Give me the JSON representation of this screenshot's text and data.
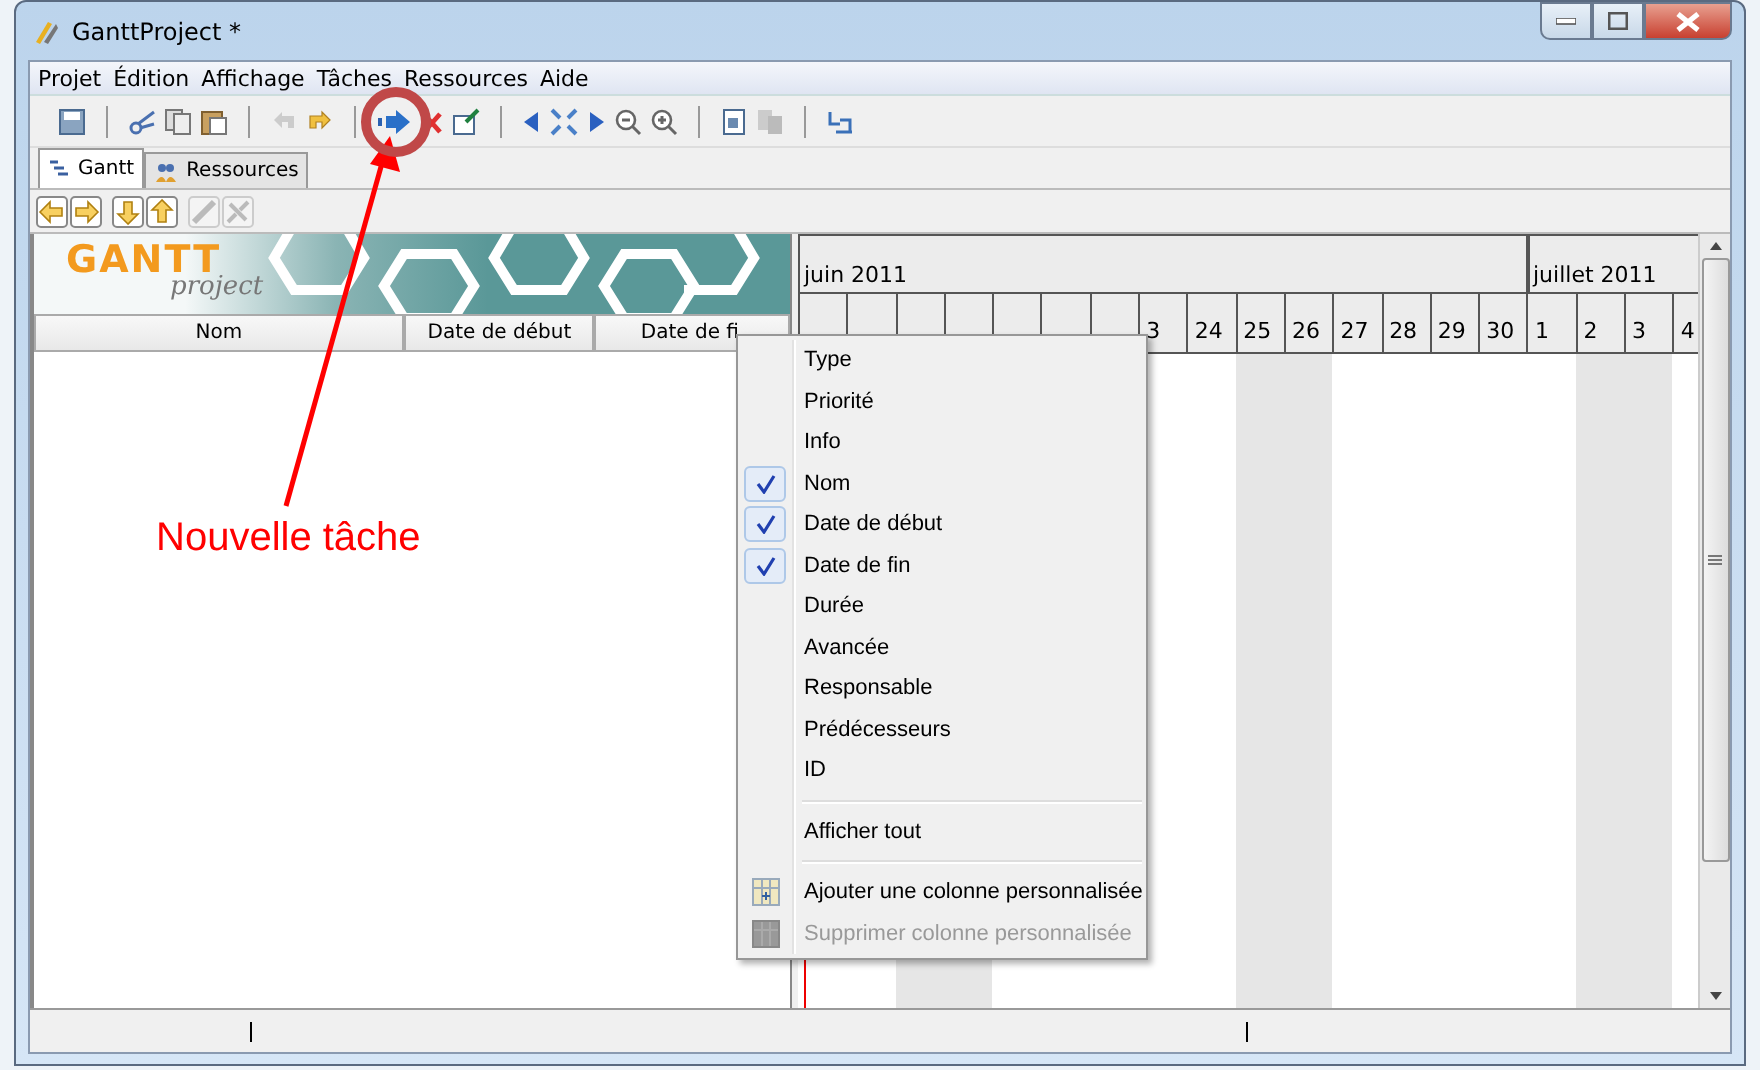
{
  "window": {
    "title": "GanttProject *"
  },
  "menu": [
    "Projet",
    "Édition",
    "Affichage",
    "Tâches",
    "Ressources",
    "Aide"
  ],
  "tabs": [
    {
      "label": "Gantt",
      "selected": true
    },
    {
      "label": "Ressources",
      "selected": false
    }
  ],
  "logo": {
    "brand": "GANTT",
    "sub": "project"
  },
  "table": {
    "columns": [
      "Nom",
      "Date de début",
      "Date de fi"
    ]
  },
  "timeline": {
    "months": [
      {
        "label": "juin 2011",
        "days": [
          {
            "weekend": false
          },
          {
            "weekend": false
          },
          {
            "weekend": true
          },
          {
            "weekend": true
          },
          {
            "weekend": false
          },
          {
            "weekend": false
          },
          {
            "weekend": false
          },
          {
            "label": "3",
            "weekend": false
          },
          {
            "label": "24",
            "weekend": false
          },
          {
            "label": "25",
            "weekend": true
          },
          {
            "label": "26",
            "weekend": true
          },
          {
            "label": "27",
            "weekend": false
          },
          {
            "label": "28",
            "weekend": false
          },
          {
            "label": "29",
            "weekend": false
          },
          {
            "label": "30",
            "weekend": false
          }
        ]
      },
      {
        "label": "juillet 2011",
        "days": [
          {
            "label": "1",
            "weekend": false
          },
          {
            "label": "2",
            "weekend": true
          },
          {
            "label": "3",
            "weekend": true
          },
          {
            "label": "4",
            "weekend": false
          }
        ]
      }
    ]
  },
  "context_menu": [
    {
      "kind": "check",
      "label": "Type",
      "checked": false
    },
    {
      "kind": "check",
      "label": "Priorité",
      "checked": false
    },
    {
      "kind": "check",
      "label": "Info",
      "checked": false
    },
    {
      "kind": "check",
      "label": "Nom",
      "checked": true
    },
    {
      "kind": "check",
      "label": "Date de début",
      "checked": true
    },
    {
      "kind": "check",
      "label": "Date de fin",
      "checked": true
    },
    {
      "kind": "check",
      "label": "Durée",
      "checked": false
    },
    {
      "kind": "check",
      "label": "Avancée",
      "checked": false
    },
    {
      "kind": "check",
      "label": "Responsable",
      "checked": false
    },
    {
      "kind": "check",
      "label": "Prédécesseurs",
      "checked": false
    },
    {
      "kind": "check",
      "label": "ID",
      "checked": false
    },
    {
      "kind": "separator"
    },
    {
      "kind": "action",
      "label": "Afficher tout"
    },
    {
      "kind": "separator"
    },
    {
      "kind": "icon",
      "label": "Ajouter une colonne personnalisée",
      "disabled": false
    },
    {
      "kind": "icon",
      "label": "Supprimer colonne personnalisée",
      "disabled": true
    }
  ],
  "annotation": {
    "text": "Nouvelle tâche"
  }
}
